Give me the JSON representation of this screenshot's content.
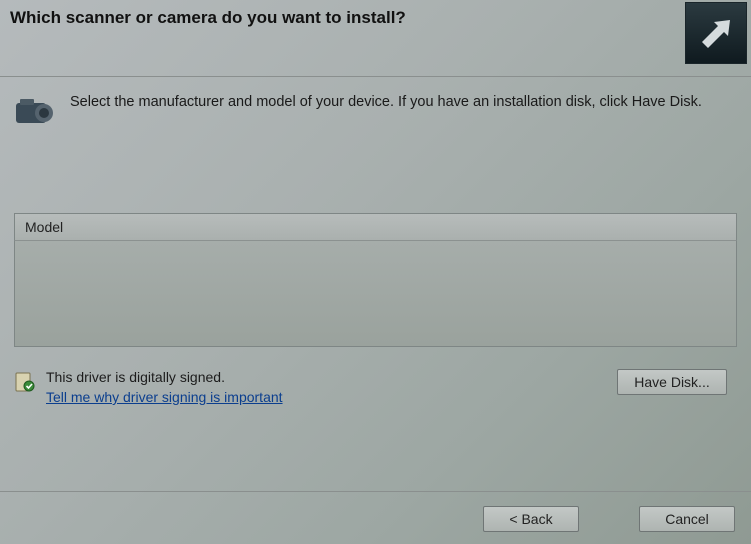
{
  "header": {
    "title": "Which scanner or camera do you want to install?"
  },
  "instruction": "Select the manufacturer and model of your device. If you have an installation disk, click Have Disk.",
  "model_header": "Model",
  "signing": {
    "status": "This driver is digitally signed.",
    "link": "Tell me why driver signing is important"
  },
  "buttons": {
    "have_disk": "Have Disk...",
    "back": "< Back",
    "cancel": "Cancel"
  }
}
